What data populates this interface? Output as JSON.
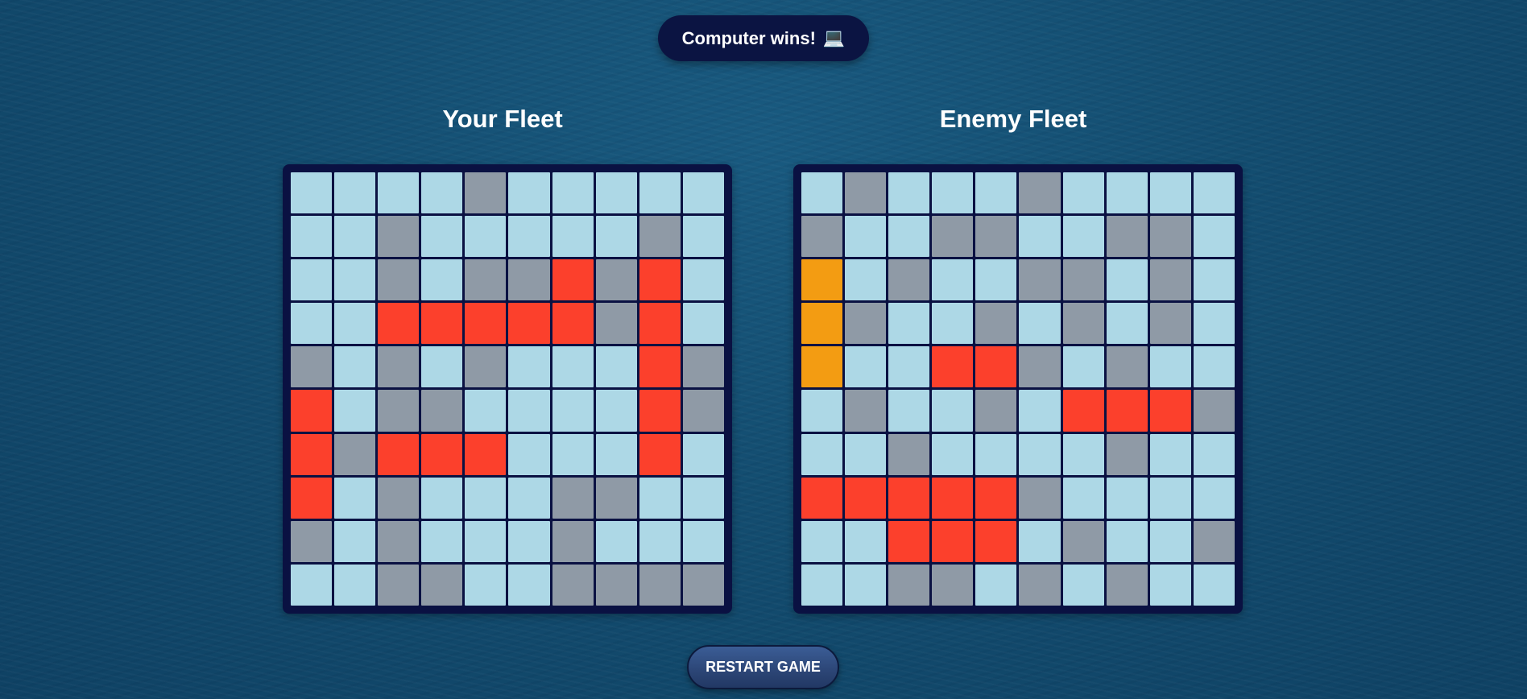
{
  "status": {
    "message": "Computer wins!",
    "icon": "laptop-icon",
    "icon_glyph": "💻"
  },
  "player": {
    "title": "Your Fleet",
    "grid": [
      "wwwwmwwwww",
      "wwmwwwwwmw",
      "wwmwmmhmhw",
      "wwhhhhhmhw",
      "mwmwmwwwhm",
      "hwmmwwwwhm",
      "hmhhhwwwhw",
      "hwmwwwmmww",
      "mwmwwwmwww",
      "wwmmwwmmmm"
    ]
  },
  "enemy": {
    "title": "Enemy Fleet",
    "grid": [
      "wmwwwmwwww",
      "mwwmmwwmmw",
      "swmwwmmwmw",
      "smwwmwmwmw",
      "swwhhmwmww",
      "wmwwmwhhhm",
      "wwmwwwwmww",
      "hhhhhmwwww",
      "wwhhhwmwwm",
      "wwmmwmwmww"
    ]
  },
  "cell_legend": {
    "w": "water",
    "m": "miss",
    "h": "hit",
    "s": "sunk"
  },
  "colors": {
    "water": "#add8e6",
    "miss": "#8f9aa6",
    "hit": "#fc402c",
    "sunk": "#f39c12",
    "board": "#0a1142",
    "status_bg": "#0b1442"
  },
  "restart_label": "RESTART GAME"
}
